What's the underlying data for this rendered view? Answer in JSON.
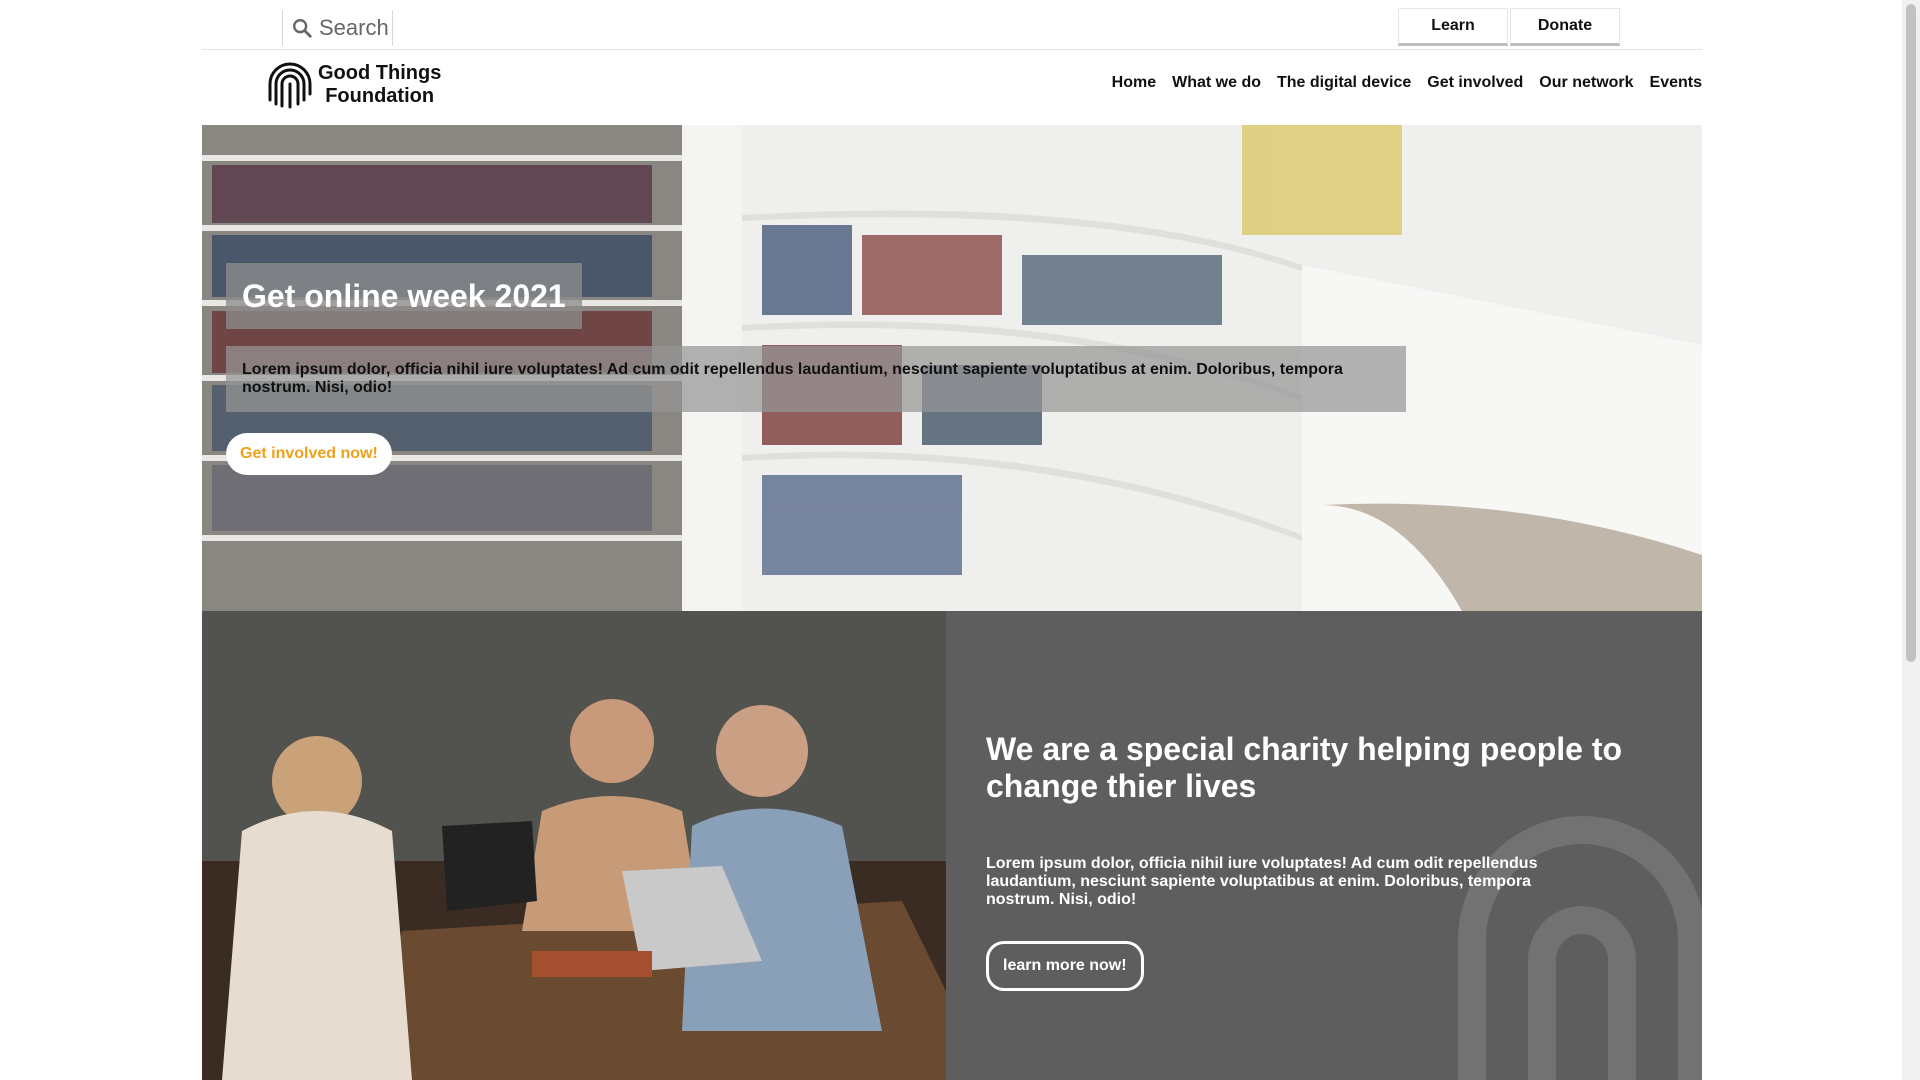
{
  "topbar": {
    "search_placeholder": "Search",
    "learn_label": "Learn",
    "donate_label": "Donate"
  },
  "brand": {
    "line1": "Good Things",
    "line2": "Foundation",
    "logo_icon": "fingerprint-icon"
  },
  "nav": {
    "items": [
      {
        "label": "Home"
      },
      {
        "label": "What we do"
      },
      {
        "label": "The digital device"
      },
      {
        "label": "Get involved"
      },
      {
        "label": "Our network"
      },
      {
        "label": "Events"
      }
    ]
  },
  "hero": {
    "title": "Get online week 2021",
    "text": "Lorem ipsum dolor, officia nihil iure voluptates! Ad cum odit repellendus laudantium, nesciunt sapiente voluptatibus at enim. Doloribus, tempora nostrum. Nisi, odio!",
    "cta_label": "Get involved now!"
  },
  "about": {
    "title": "We are a special charity helping people to change thier lives",
    "text": "Lorem ipsum dolor, officia nihil iure voluptates! Ad cum odit repellendus laudantium, nesciunt sapiente voluptatibus at enim. Doloribus, tempora nostrum. Nisi, odio!",
    "cta_label": "learn more now!"
  },
  "colors": {
    "accent": "#f1a119",
    "panel": "#5e5e5e"
  }
}
